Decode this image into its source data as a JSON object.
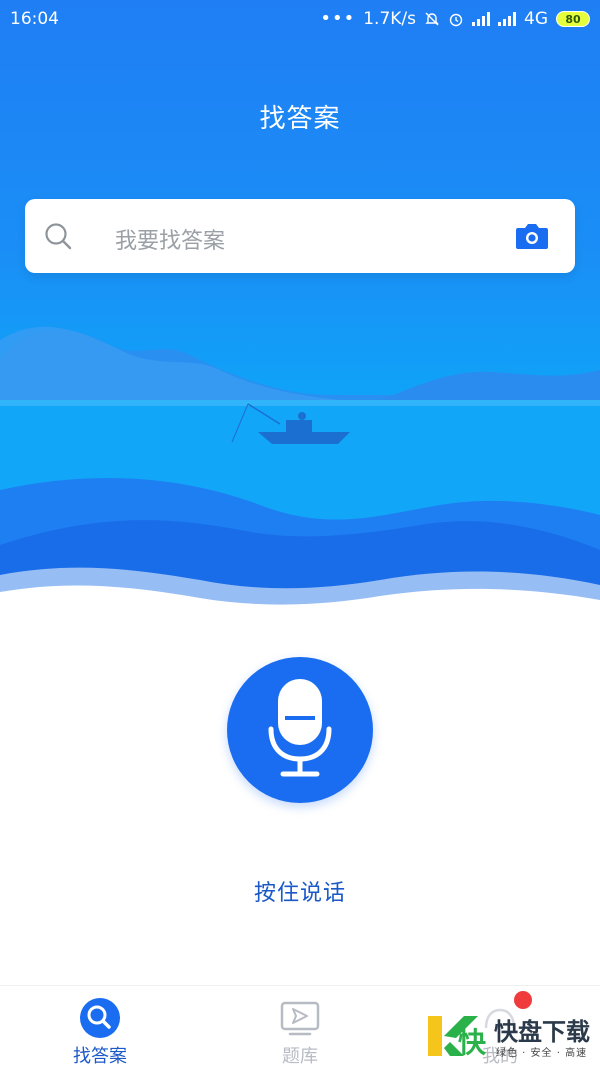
{
  "status_bar": {
    "time": "16:04",
    "overflow": "•••",
    "net_speed": "1.7K/s",
    "network": "4G",
    "battery": "80"
  },
  "header": {
    "title": "找答案"
  },
  "search": {
    "placeholder": "我要找答案"
  },
  "voice": {
    "hint": "按住说话"
  },
  "tabs": [
    {
      "label": "找答案",
      "icon": "search-tab-icon",
      "active": true
    },
    {
      "label": "题库",
      "icon": "play-tab-icon",
      "active": false
    },
    {
      "label": "我的",
      "icon": "profile-tab-icon",
      "active": false
    }
  ],
  "watermark": {
    "brand": "快盘下载",
    "slogan": "绿色 · 安全 · 高速"
  },
  "colors": {
    "primary": "#1a6df0",
    "hero_top": "#1f7ef4",
    "hero_water": "#0fa3f8",
    "tab_active": "#1b59c9",
    "notify": "#ef3b3b"
  }
}
